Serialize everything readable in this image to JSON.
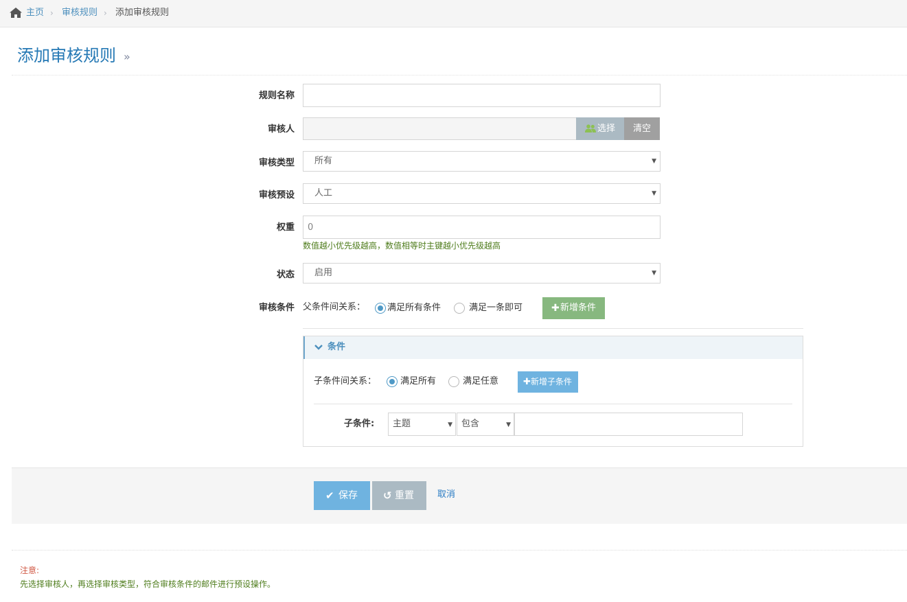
{
  "breadcrumb": {
    "home": "主页",
    "rules": "审核规则",
    "current": "添加审核规则"
  },
  "page": {
    "title": "添加审核规则",
    "title_chevron": "»"
  },
  "form": {
    "rule_name_label": "规则名称",
    "rule_name_value": "",
    "reviewer_label": "审核人",
    "reviewer_value": "",
    "select_button": "选择",
    "clear_button": "清空",
    "review_type_label": "审核类型",
    "review_type_value": "所有",
    "preset_label": "审核预设",
    "preset_value": "人工",
    "weight_label": "权重",
    "weight_value": "0",
    "weight_help": "数值越小优先级越高，数值相等时主键越小优先级越高",
    "status_label": "状态",
    "status_value": "启用",
    "conditions_label": "审核条件",
    "parent_relation_label": "父条件间关系：",
    "parent_relation_options": [
      "满足所有条件",
      "满足一条即可"
    ],
    "parent_relation_selected": 0,
    "add_condition_button": "新增条件"
  },
  "condition_panel": {
    "title": "条件",
    "child_relation_label": "子条件间关系：",
    "child_relation_options": [
      "满足所有",
      "满足任意"
    ],
    "child_relation_selected": 0,
    "add_child_button": "新增子条件",
    "child_label": "子条件:",
    "field_value": "主题",
    "operator_value": "包含",
    "match_value": ""
  },
  "actions": {
    "save": "保存",
    "reset": "重置",
    "cancel": "取消"
  },
  "notice": {
    "title": "注意:",
    "text": "先选择审核人，再选择审核类型，符合审核条件的邮件进行预设操作。"
  },
  "colors": {
    "accent": "#4c8fbd",
    "save_button": "#6fb3e0",
    "reset_button": "#abbac3",
    "add_condition_button": "#87b87f",
    "select_button": "#abbac3",
    "clear_button": "#a0a0a0",
    "help_text": "#4f7d1d",
    "notice_title": "#d15b47"
  }
}
